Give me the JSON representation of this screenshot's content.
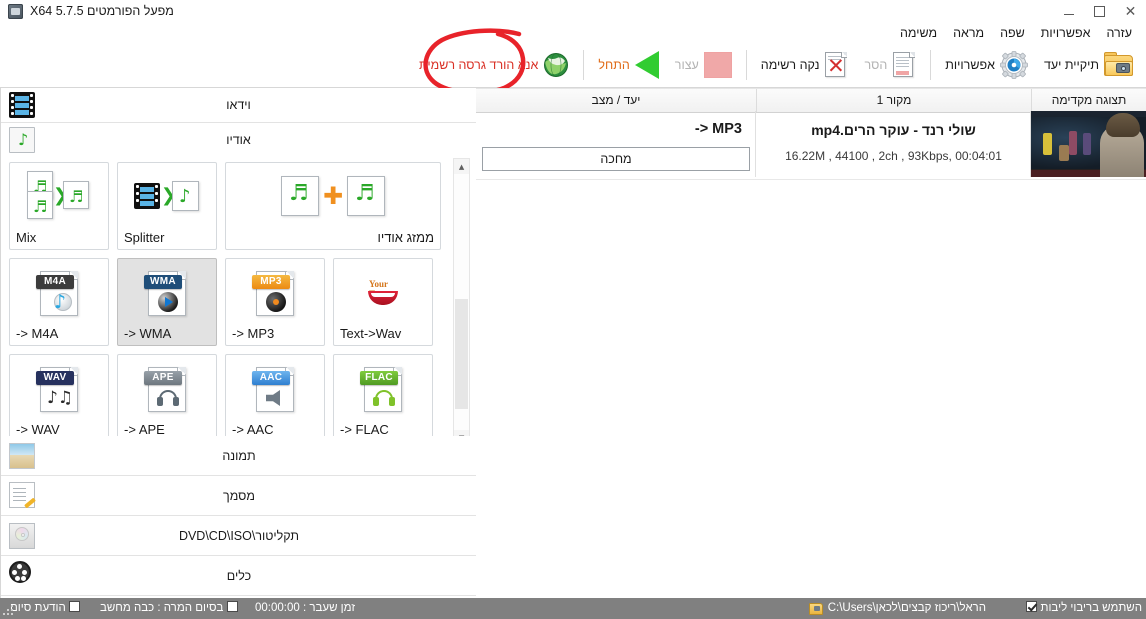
{
  "window": {
    "title": "מפעל הפורמטים X64 5.7.5",
    "app_icon": "format-factory-icon",
    "controls": {
      "minimize": "–",
      "maximize": "□",
      "close": "✕"
    }
  },
  "menu": {
    "items": [
      {
        "label": "עזרה"
      },
      {
        "label": "אפשרויות"
      },
      {
        "label": "שפה"
      },
      {
        "label": "מראה"
      },
      {
        "label": "משימה"
      }
    ]
  },
  "toolbar": {
    "buttons": [
      {
        "label": "תיקיית יעד",
        "icon": "folder-camera-icon",
        "enabled": true
      },
      {
        "label": "אפשרויות",
        "icon": "gear-icon",
        "enabled": true
      },
      {
        "label": "הסר",
        "icon": "remove-document-icon",
        "enabled": false
      },
      {
        "label": "נקה רשימה",
        "icon": "clear-list-icon",
        "enabled": true
      },
      {
        "label": "עצור",
        "icon": "stop-icon",
        "enabled": false
      },
      {
        "label": "התחל",
        "icon": "play-icon",
        "enabled": true
      }
    ],
    "official_link": {
      "label": "אנא הורד גרסה רשמית",
      "icon": "globe-icon"
    }
  },
  "annotation": {
    "type": "red-circle",
    "target": "התחל",
    "color": "#e8232a"
  },
  "sidebar": {
    "top_categories": [
      {
        "label": "וידאו",
        "icon": "film-strip-icon"
      },
      {
        "label": "אודיו",
        "icon": "audio-note-icon"
      }
    ],
    "bottom_categories": [
      {
        "label": "תמונה",
        "icon": "picture-icon"
      },
      {
        "label": "מסמך",
        "icon": "document-pencil-icon"
      },
      {
        "label": "תקליטור\\DVD\\CD\\ISO",
        "icon": "disc-drive-icon"
      },
      {
        "label": "כלים",
        "icon": "film-reel-icon"
      }
    ]
  },
  "tiles": {
    "rows": [
      [
        {
          "label": "ממזג אודיו",
          "icon": "audio-merge-icon",
          "wide": true,
          "selected": false,
          "rtl": true
        },
        {
          "label": "Splitter",
          "icon": "splitter-icon",
          "wide": false,
          "selected": false,
          "rtl": false
        },
        {
          "label": "Mix",
          "icon": "mix-icon",
          "wide": false,
          "selected": false,
          "rtl": false
        }
      ],
      [
        {
          "label": "Text->Wav",
          "icon": "text-to-wav-icon",
          "badge": "",
          "badge_color": "",
          "selected": false
        },
        {
          "label": "-> MP3",
          "icon": "mp3-file-icon",
          "badge": "MP3",
          "badge_color": "#f0941f",
          "selected": false
        },
        {
          "label": "-> WMA",
          "icon": "wma-file-icon",
          "badge": "WMA",
          "badge_color": "#1f4e79",
          "selected": true
        },
        {
          "label": "-> M4A",
          "icon": "m4a-file-icon",
          "badge": "M4A",
          "badge_color": "#3c3c3c",
          "selected": false
        }
      ],
      [
        {
          "label": "-> FLAC",
          "icon": "flac-file-icon",
          "badge": "FLAC",
          "badge_color": "#5aa82a",
          "selected": false
        },
        {
          "label": "-> AAC",
          "icon": "aac-file-icon",
          "badge": "AAC",
          "badge_color": "#3b8fe0",
          "selected": false
        },
        {
          "label": "-> APE",
          "icon": "ape-file-icon",
          "badge": "APE",
          "badge_color": "#77818a",
          "selected": false
        },
        {
          "label": "-> WAV",
          "icon": "wav-file-icon",
          "badge": "WAV",
          "badge_color": "#26315e",
          "selected": false
        }
      ]
    ]
  },
  "scrollbar": {
    "up_arrow": "▲",
    "down_arrow": "▼"
  },
  "list": {
    "columns": [
      {
        "label": "יעד / מצב"
      },
      {
        "label": "מקור 1"
      },
      {
        "label": "תצוגה מקדימה"
      }
    ],
    "rows": [
      {
        "thumbnail": "video-frame-thumbnail",
        "filename": "שולי רנד - עוקר הרים.mp4",
        "meta": "16.22M , 44100 , 2ch , 93Kbps, 00:04:01",
        "target": "-> MP3",
        "status": "מחכה"
      }
    ]
  },
  "statusbar": {
    "output_path": "C:\\Users\\הראל\\ריכוז קבצים\\לכאן",
    "folder_icon": "folder-icon",
    "multicore": {
      "label": "השתמש בריבוי ליבות",
      "checked": true
    },
    "elapsed": "זמן שעבר : 00:00:00",
    "shutdown": {
      "label": "בסיום המרה : כבה מחשב",
      "checked": false
    },
    "finish_notice": {
      "label": "הודעת סיום",
      "checked": false
    }
  }
}
